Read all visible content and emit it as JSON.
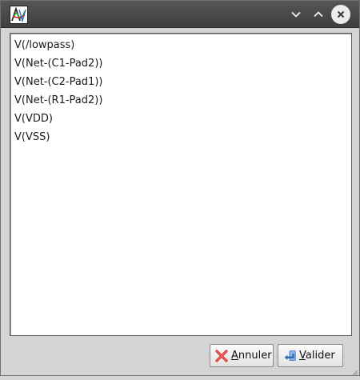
{
  "window": {
    "app_icon": "kicad-simulator-icon",
    "title_controls": [
      "minimize-icon",
      "maximize-icon",
      "close-icon"
    ]
  },
  "signals": {
    "items": [
      "V(/lowpass)",
      "V(Net-(C1-Pad2))",
      "V(Net-(C2-Pad1))",
      "V(Net-(R1-Pad2))",
      "V(VDD)",
      "V(VSS)"
    ]
  },
  "buttons": {
    "cancel": {
      "mnemonic": "A",
      "rest": "nnuler",
      "icon": "cancel-x-icon"
    },
    "ok": {
      "mnemonic": "V",
      "rest": "alider",
      "icon": "enter-arrow-icon"
    }
  },
  "colors": {
    "titlebar": "#4a4a4a",
    "dialog_bg": "#d4d4d4",
    "list_bg": "#ffffff",
    "cancel_icon": "#d9302c",
    "ok_icon": "#3a79c9"
  }
}
